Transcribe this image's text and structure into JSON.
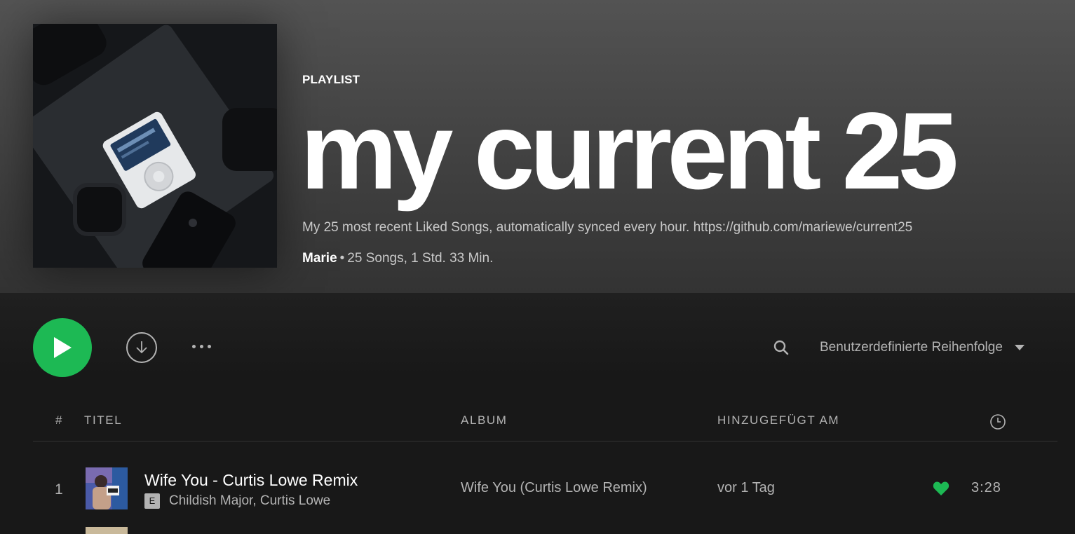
{
  "playlist": {
    "type_label": "PLAYLIST",
    "title": "my current 25",
    "description": "My 25 most recent Liked Songs, automatically synced every hour. https://github.com/mariewe/current25",
    "owner": "Marie",
    "separator": "•",
    "stats": "25 Songs, 1 Std. 33 Min.",
    "cover_icon": "ipod-on-desk-photo"
  },
  "controls": {
    "play_icon": "play-icon",
    "download_icon": "download-icon",
    "more_icon": "more-icon",
    "search_icon": "search-icon",
    "sort_label": "Benutzerdefinierte Reihenfolge",
    "sort_icon": "caret-down-icon"
  },
  "table": {
    "columns": {
      "number": "#",
      "title": "TITEL",
      "album": "ALBUM",
      "added": "HINZUGEFÜGT AM",
      "duration_icon": "clock-icon"
    },
    "rows": [
      {
        "number": "1",
        "title": "Wife You - Curtis Lowe Remix",
        "explicit": "E",
        "artists": "Childish Major, Curtis Lowe",
        "album": "Wife You (Curtis Lowe Remix)",
        "added": "vor 1 Tag",
        "liked": true,
        "duration": "3:28"
      }
    ]
  },
  "colors": {
    "accent": "#1db954",
    "background": "#181818",
    "header_gradient_top": "#535353",
    "text_secondary": "#b3b3b3"
  }
}
